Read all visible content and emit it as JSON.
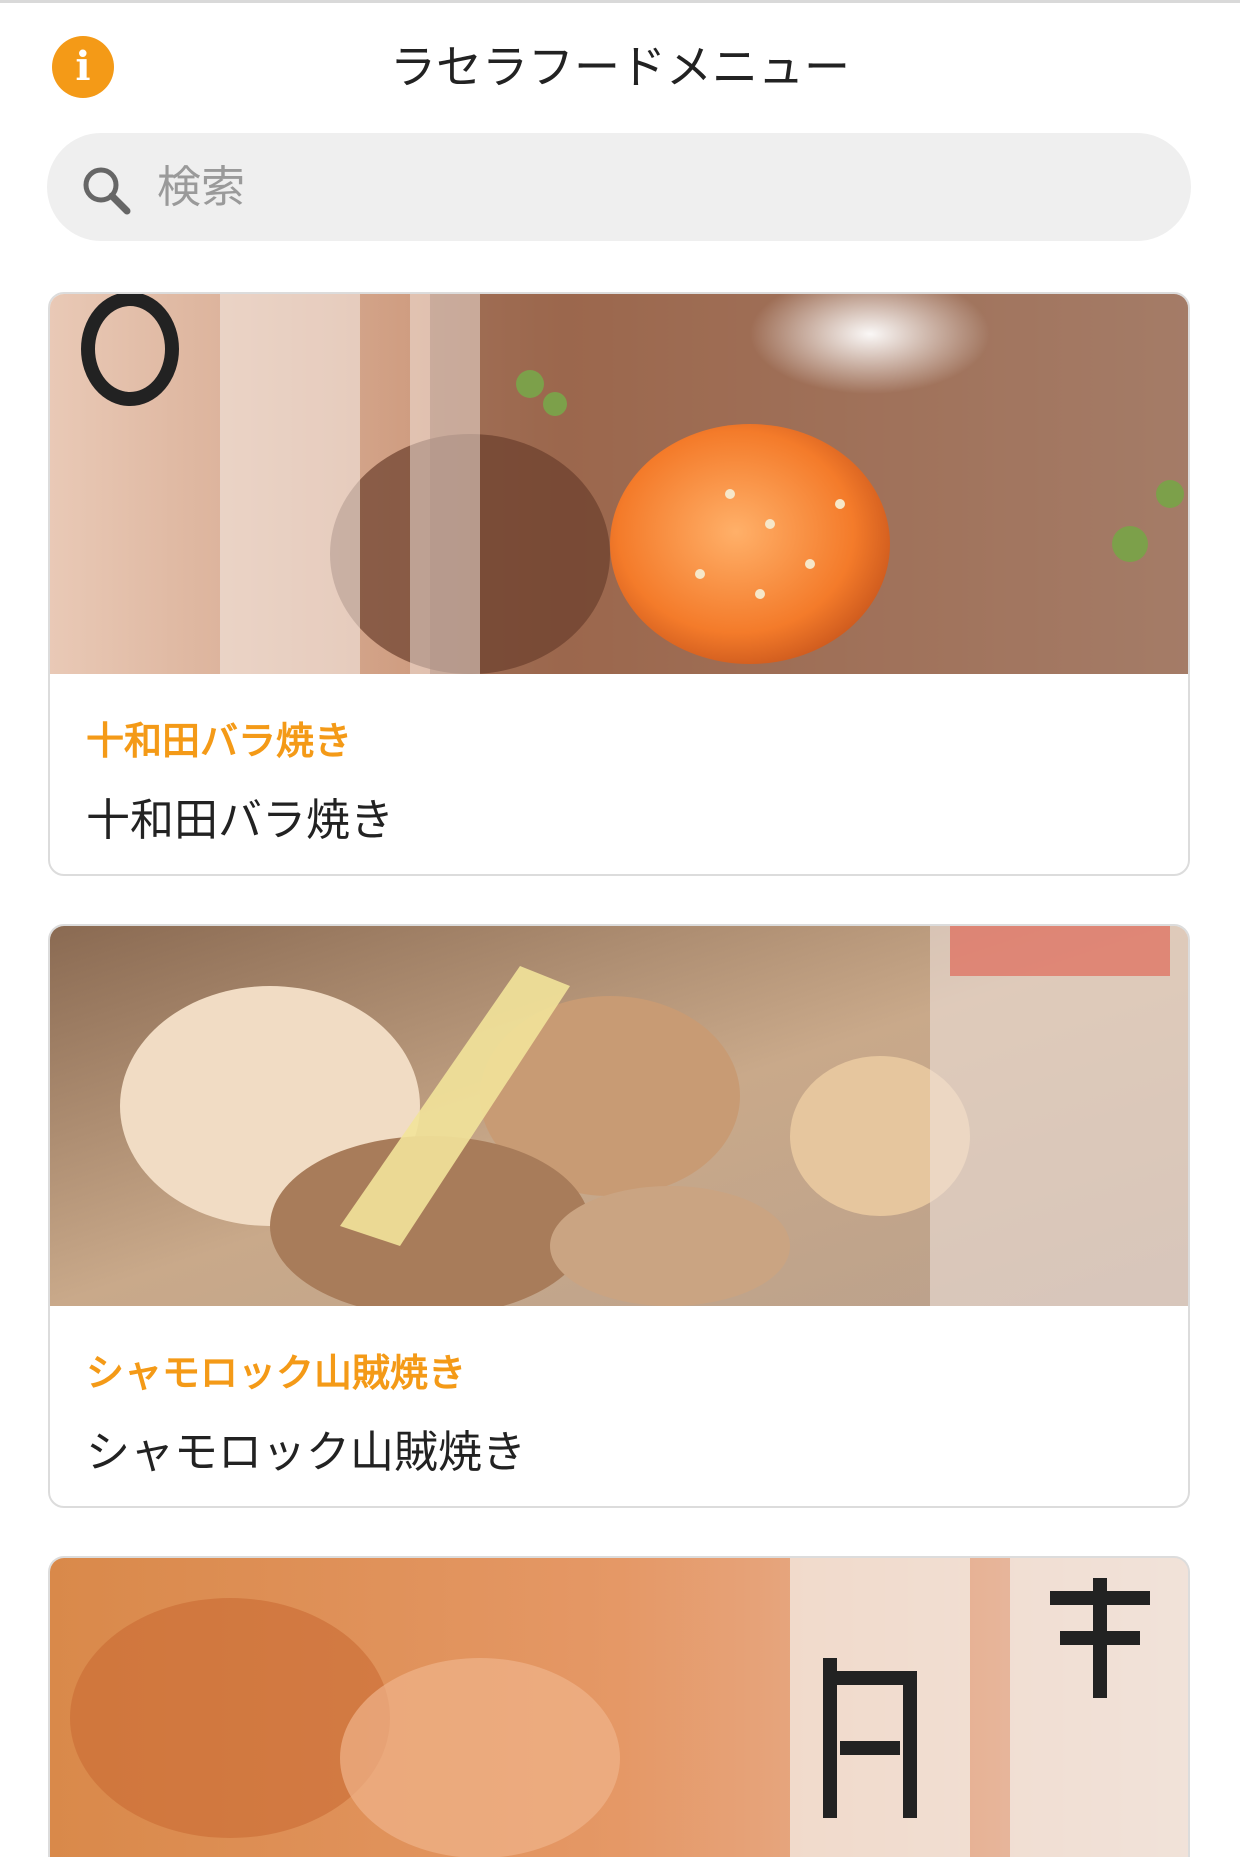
{
  "header": {
    "title": "ラセラフードメニュー",
    "info_icon": "info-icon",
    "accent_color": "#f49a17"
  },
  "search": {
    "placeholder": "検索",
    "value": "",
    "icon": "search-icon"
  },
  "menu_items": [
    {
      "category_label": "十和田バラ焼き",
      "name": "十和田バラ焼き"
    },
    {
      "category_label": "シャモロック山賊焼き",
      "name": "シャモロック山賊焼き"
    },
    {
      "category_label": "",
      "name": ""
    }
  ]
}
